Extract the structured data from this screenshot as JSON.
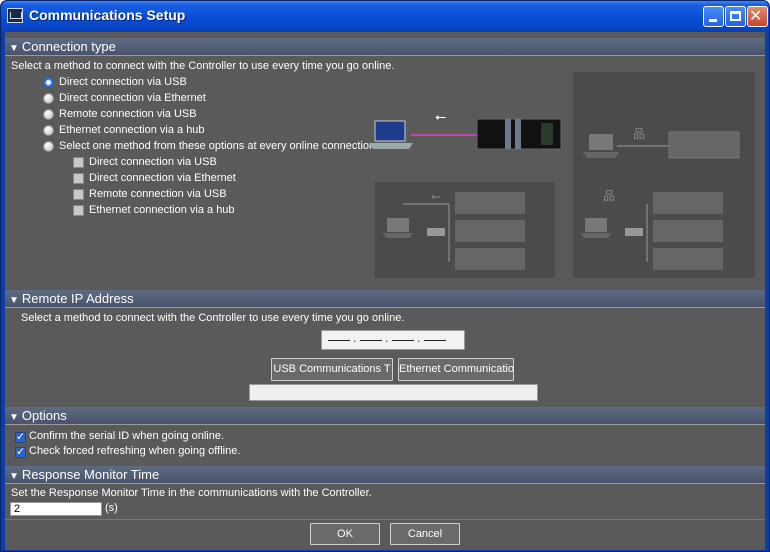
{
  "window": {
    "title": "Communications Setup"
  },
  "connection_type": {
    "header": "Connection type",
    "instruction": "Select a method to connect with the Controller to use every time you go online.",
    "options": [
      {
        "label": "Direct connection via USB",
        "selected": true
      },
      {
        "label": "Direct connection via Ethernet",
        "selected": false
      },
      {
        "label": "Remote connection via USB",
        "selected": false
      },
      {
        "label": "Ethernet connection via a hub",
        "selected": false
      },
      {
        "label": "Select one method from these options at every online connection.",
        "selected": false
      }
    ],
    "sub_options": [
      {
        "label": "Direct connection via USB",
        "checked": false
      },
      {
        "label": "Direct connection via Ethernet",
        "checked": false
      },
      {
        "label": "Remote connection via USB",
        "checked": false
      },
      {
        "label": "Ethernet connection via a hub",
        "checked": false
      }
    ]
  },
  "remote_ip": {
    "header": "Remote IP Address",
    "instruction": "Select a method to connect with the Controller to use every time you go online.",
    "usb_button": "USB Communications T",
    "ethernet_button": "Ethernet Communicatio",
    "status_text": ""
  },
  "options": {
    "header": "Options",
    "items": [
      {
        "label": "Confirm the serial ID when going online.",
        "checked": true
      },
      {
        "label": "Check forced refreshing when going offline.",
        "checked": true
      }
    ]
  },
  "response_monitor": {
    "header": "Response Monitor Time",
    "instruction": "Set the Response Monitor Time in the communications with the Controller.",
    "value": "2",
    "unit": "(s)"
  },
  "buttons": {
    "ok": "OK",
    "cancel": "Cancel"
  },
  "colors": {
    "accent": "#3b7ee8",
    "wire": "#e040c8",
    "titlebar": "#0a4fd8"
  }
}
